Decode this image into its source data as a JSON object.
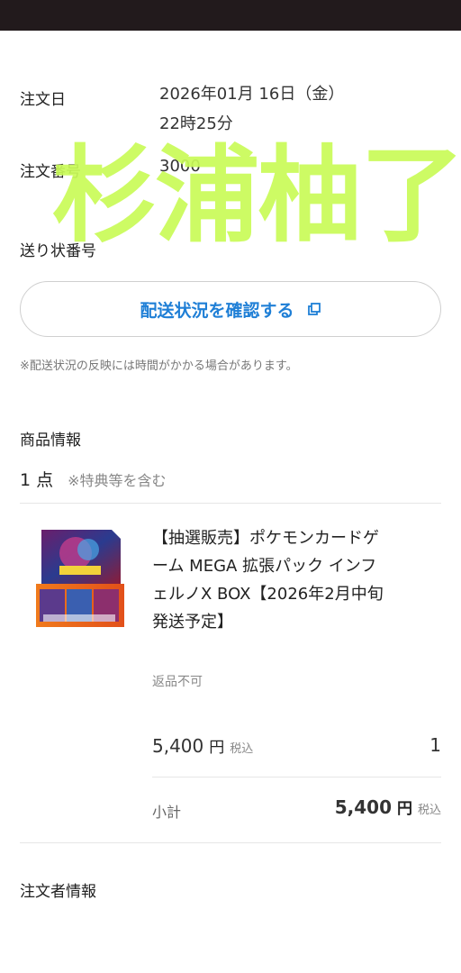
{
  "order": {
    "date_label": "注文日",
    "date_line1": "2026年01月 16日（金）",
    "date_line2": "22時25分",
    "number_label": "注文番号",
    "number_value": "3000",
    "tracking_label": "送り状番号"
  },
  "tracking_button": {
    "label": "配送状況を確認する",
    "icon": "external-link-icon"
  },
  "tracking_note": "※配送状況の反映には時間がかかる場合があります。",
  "product_section": {
    "title": "商品情報",
    "count": "1 点",
    "count_note": "※特典等を含む"
  },
  "product": {
    "title_lines": [
      "【抽選販売】ポケモンカードゲ",
      "ーム MEGA 拡張パック インフ",
      "ェルノX BOX【2026年2月中旬",
      "発送予定】"
    ],
    "return_policy": "返品不可",
    "price": "5,400",
    "yen": "円",
    "tax": "税込",
    "quantity": "1",
    "subtotal_label": "小計",
    "subtotal_value": "5,400",
    "subtotal_yen": "円",
    "subtotal_tax": "税込"
  },
  "orderer_section": {
    "title": "注文者情報"
  },
  "watermark": "杉浦柚了",
  "colors": {
    "accent": "#1f7fd6",
    "watermark": "#c9fb57",
    "topbar": "#221a1c"
  }
}
